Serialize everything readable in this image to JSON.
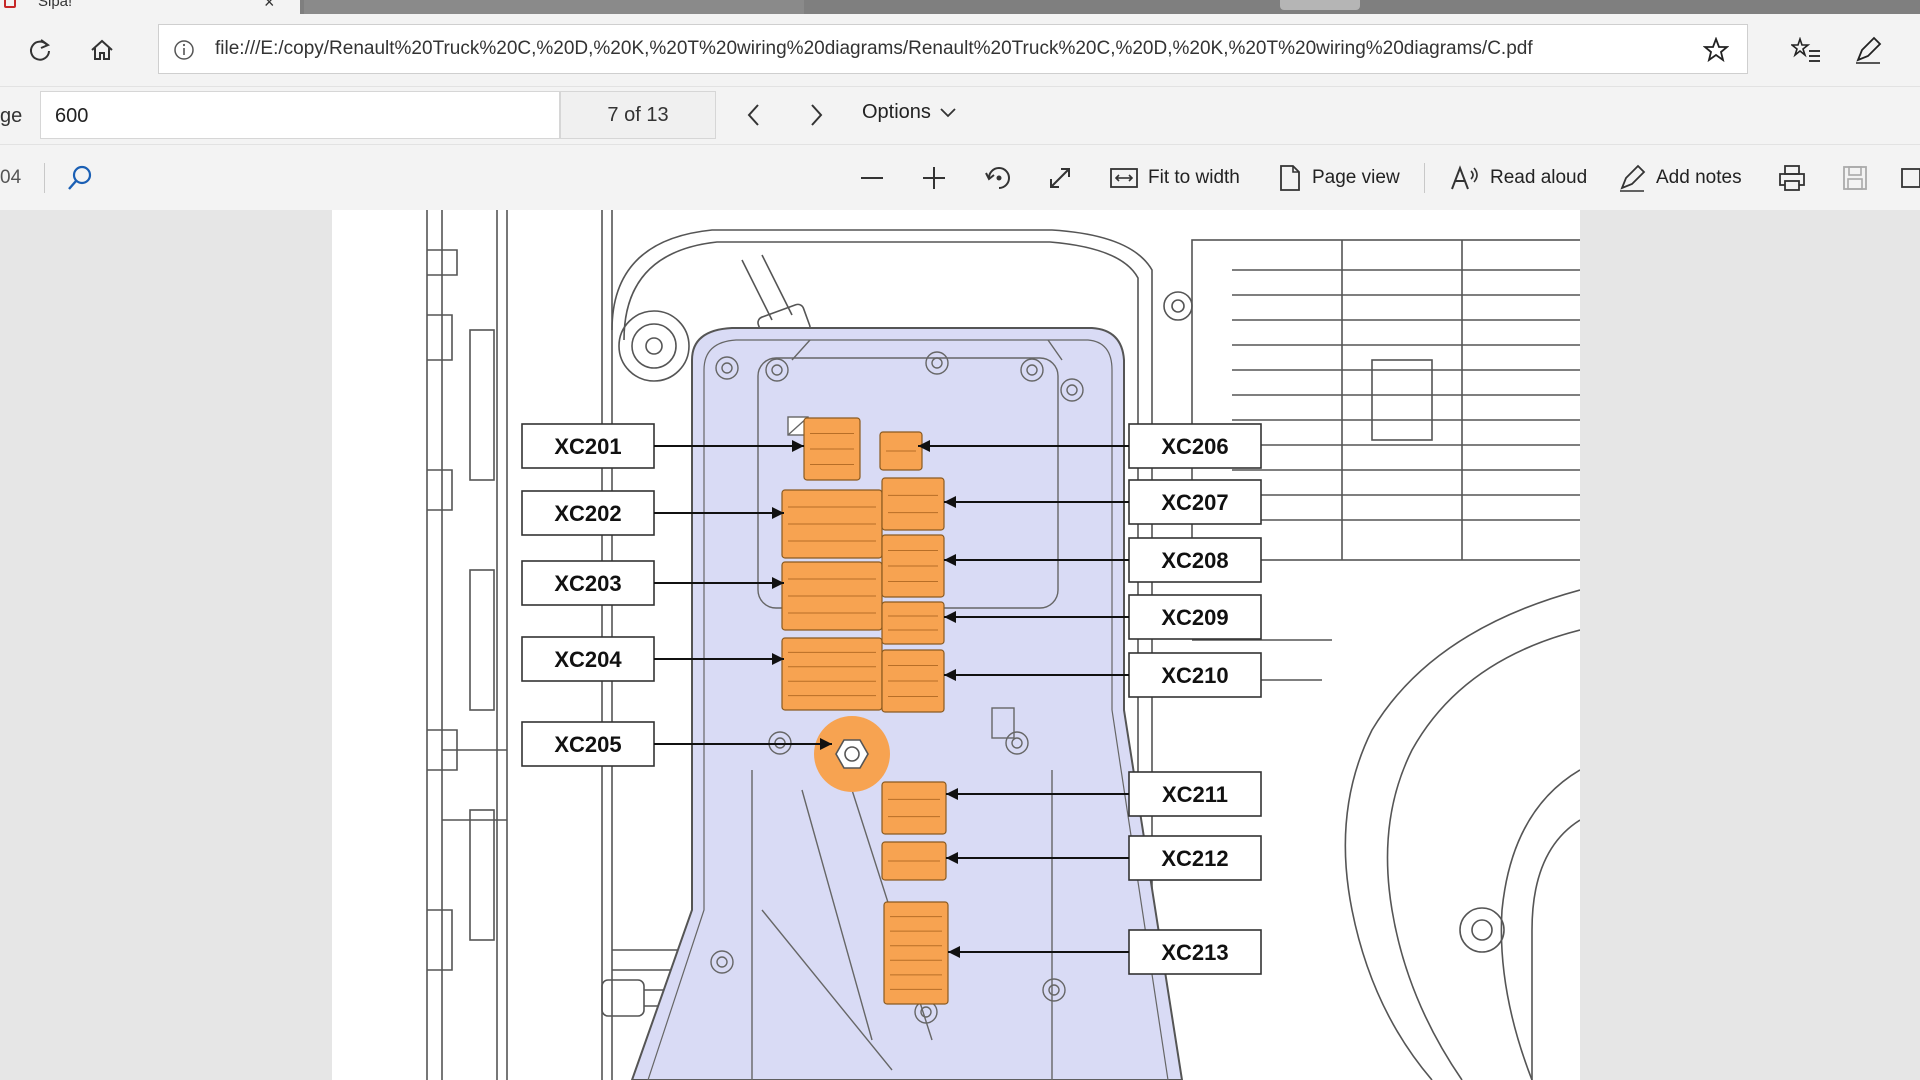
{
  "browser": {
    "tabs": [
      {
        "title": "Sipa!",
        "active": true
      },
      {
        "title": "",
        "active": false
      }
    ],
    "url": "file:///E:/copy/Renault%20Truck%20C,%20D,%20K,%20T%20wiring%20diagrams/Renault%20Truck%20C,%20D,%20K,%20T%20wiring%20diagrams/C.pdf"
  },
  "findbar": {
    "label": "ge",
    "page_input": "600",
    "page_count": "7 of 13",
    "options_label": "Options"
  },
  "pdf_toolbar": {
    "left_fragment": "04",
    "fit_to_width": "Fit to width",
    "page_view": "Page view",
    "read_aloud": "Read aloud",
    "add_notes": "Add notes"
  },
  "diagram": {
    "accent": "#f7a351",
    "panel_color": "#d9dbf5",
    "connectors_left": [
      "XC201",
      "XC202",
      "XC203",
      "XC204",
      "XC205"
    ],
    "connectors_right": [
      "XC206",
      "XC207",
      "XC208",
      "XC209",
      "XC210",
      "XC211",
      "XC212",
      "XC213"
    ]
  }
}
